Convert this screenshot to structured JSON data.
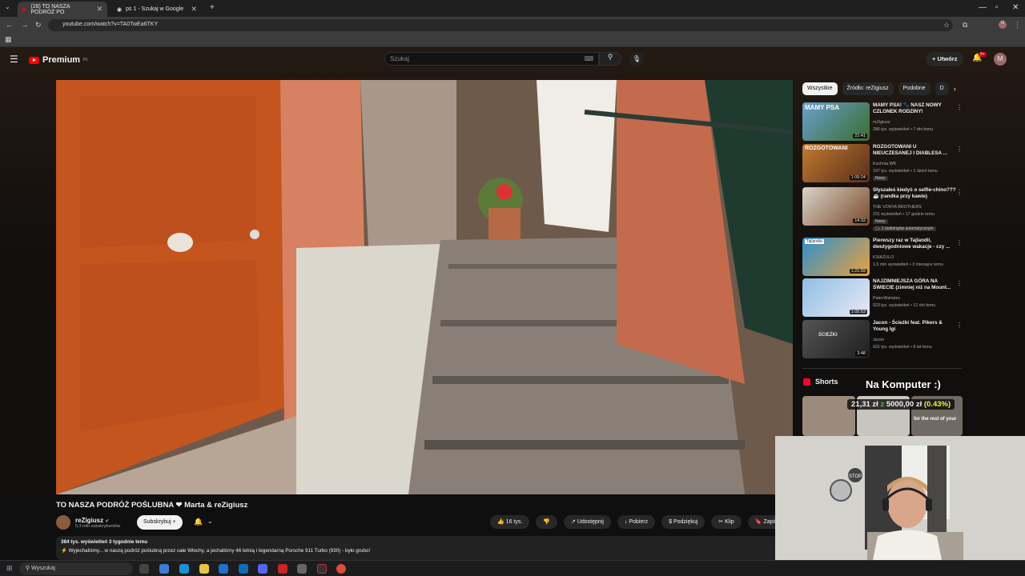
{
  "browser": {
    "tabs": [
      {
        "label": "(28) TO NASZA PODRÓŻ PO"
      },
      {
        "label": "ps 1 - Szukaj w Google"
      }
    ],
    "url": "youtube.com/watch?v=TA0TwEa6TKY"
  },
  "header": {
    "logo": "Premium",
    "logo_sup": "PL",
    "search_placeholder": "Szukaj",
    "create_label": "Utwórz",
    "notif_count": "9+",
    "avatar_letter": "M"
  },
  "video": {
    "title": "TO NASZA PODRÓŻ POŚLUBNA ❤ Marta & reZigiusz",
    "channel": "reZigiusz",
    "subscribers": "5,3 mln subskrybentów",
    "subscribe_label": "Subskrybuj",
    "likes": "16 tys.",
    "share": "Udostępnij",
    "download": "Pobierz",
    "thanks": "Podziękuj",
    "clip": "Klip",
    "save": "Zapisz",
    "views_line": "384 tys. wyświetleń  3 tygodnie temu",
    "desc_line": "⚡ Wyjechaliśmy... w naszą podróż poślubną przez całe Włochy, a jechaliśmy 46 letnią i legendarną Porsche 911 Turbo (930) - było grubo!"
  },
  "chips": [
    "Wszystkie",
    "Źródło: reZigiusz",
    "Podobne",
    "D"
  ],
  "recommendations": [
    {
      "title": "MAMY PSA! 🐾 NASZ NOWY CZLONEK RODZINY!",
      "channel": "reZigiusz",
      "meta": "286 tys. wyświetleń • 7 dni temu",
      "duration": "22:41",
      "thumb_text": "MAMY PSA",
      "tag": ""
    },
    {
      "title": "ROZGOTOWANI U NIEUCZESANEJ I DIABLESA ...",
      "channel": "Kuchnia WK",
      "meta": "197 tys. wyświetleń • 1 dzień temu",
      "duration": "1:09:24",
      "thumb_text": "ROZGOTOWANI",
      "tag": "Nowy"
    },
    {
      "title": "Słyszałeś kiedyś o selfie-chino??? ☕ (randka przy kawie)",
      "channel": "THE VONYA BROTHERS",
      "meta": "231 wyświetleń • 17 godzin temu",
      "duration": "14:32",
      "thumb_text": "",
      "tag": "Nowy",
      "tag2": "2 dubbingów automatycznym"
    },
    {
      "title": "Pierwszy raz w Tajlandii, dwutygodniowe wakacje - czy ...",
      "channel": "KSIAŻULO",
      "meta": "1,6 mln wyświetleń • 3 miesiące temu",
      "duration": "1:21:59",
      "thumb_text": "Tajlandia",
      "tag": ""
    },
    {
      "title": "NAJZIMNIEJSZA GÓRA NA ŚWIECIE (zimniej niż na Mount...",
      "channel": "PatecWariatec",
      "meta": "923 tys. wyświetleń • 12 dni temu",
      "duration": "1:05:53",
      "thumb_text": "",
      "tag": ""
    },
    {
      "title": "Jacon - Ścieżki feat. Pikers & Young Igi",
      "channel": "Jacon",
      "meta": "931 tys. wyświetleń • 8 lat temu",
      "duration": "3:48",
      "thumb_text": "ŚCIEŻKI",
      "tag": ""
    }
  ],
  "shorts_label": "Shorts",
  "overlay": {
    "headline": "Na Komputer :)",
    "amount": "21,31 zł",
    "of": "z",
    "goal": "5000,00 zł",
    "percent": "(0.43%)",
    "shorts_caption": "for the rest of your"
  },
  "webcam_sign": "STOP",
  "taskbar": {
    "search": "Wyszukaj"
  },
  "colors": {
    "accent": "#ff0000",
    "bg": "#0f0f0f"
  }
}
